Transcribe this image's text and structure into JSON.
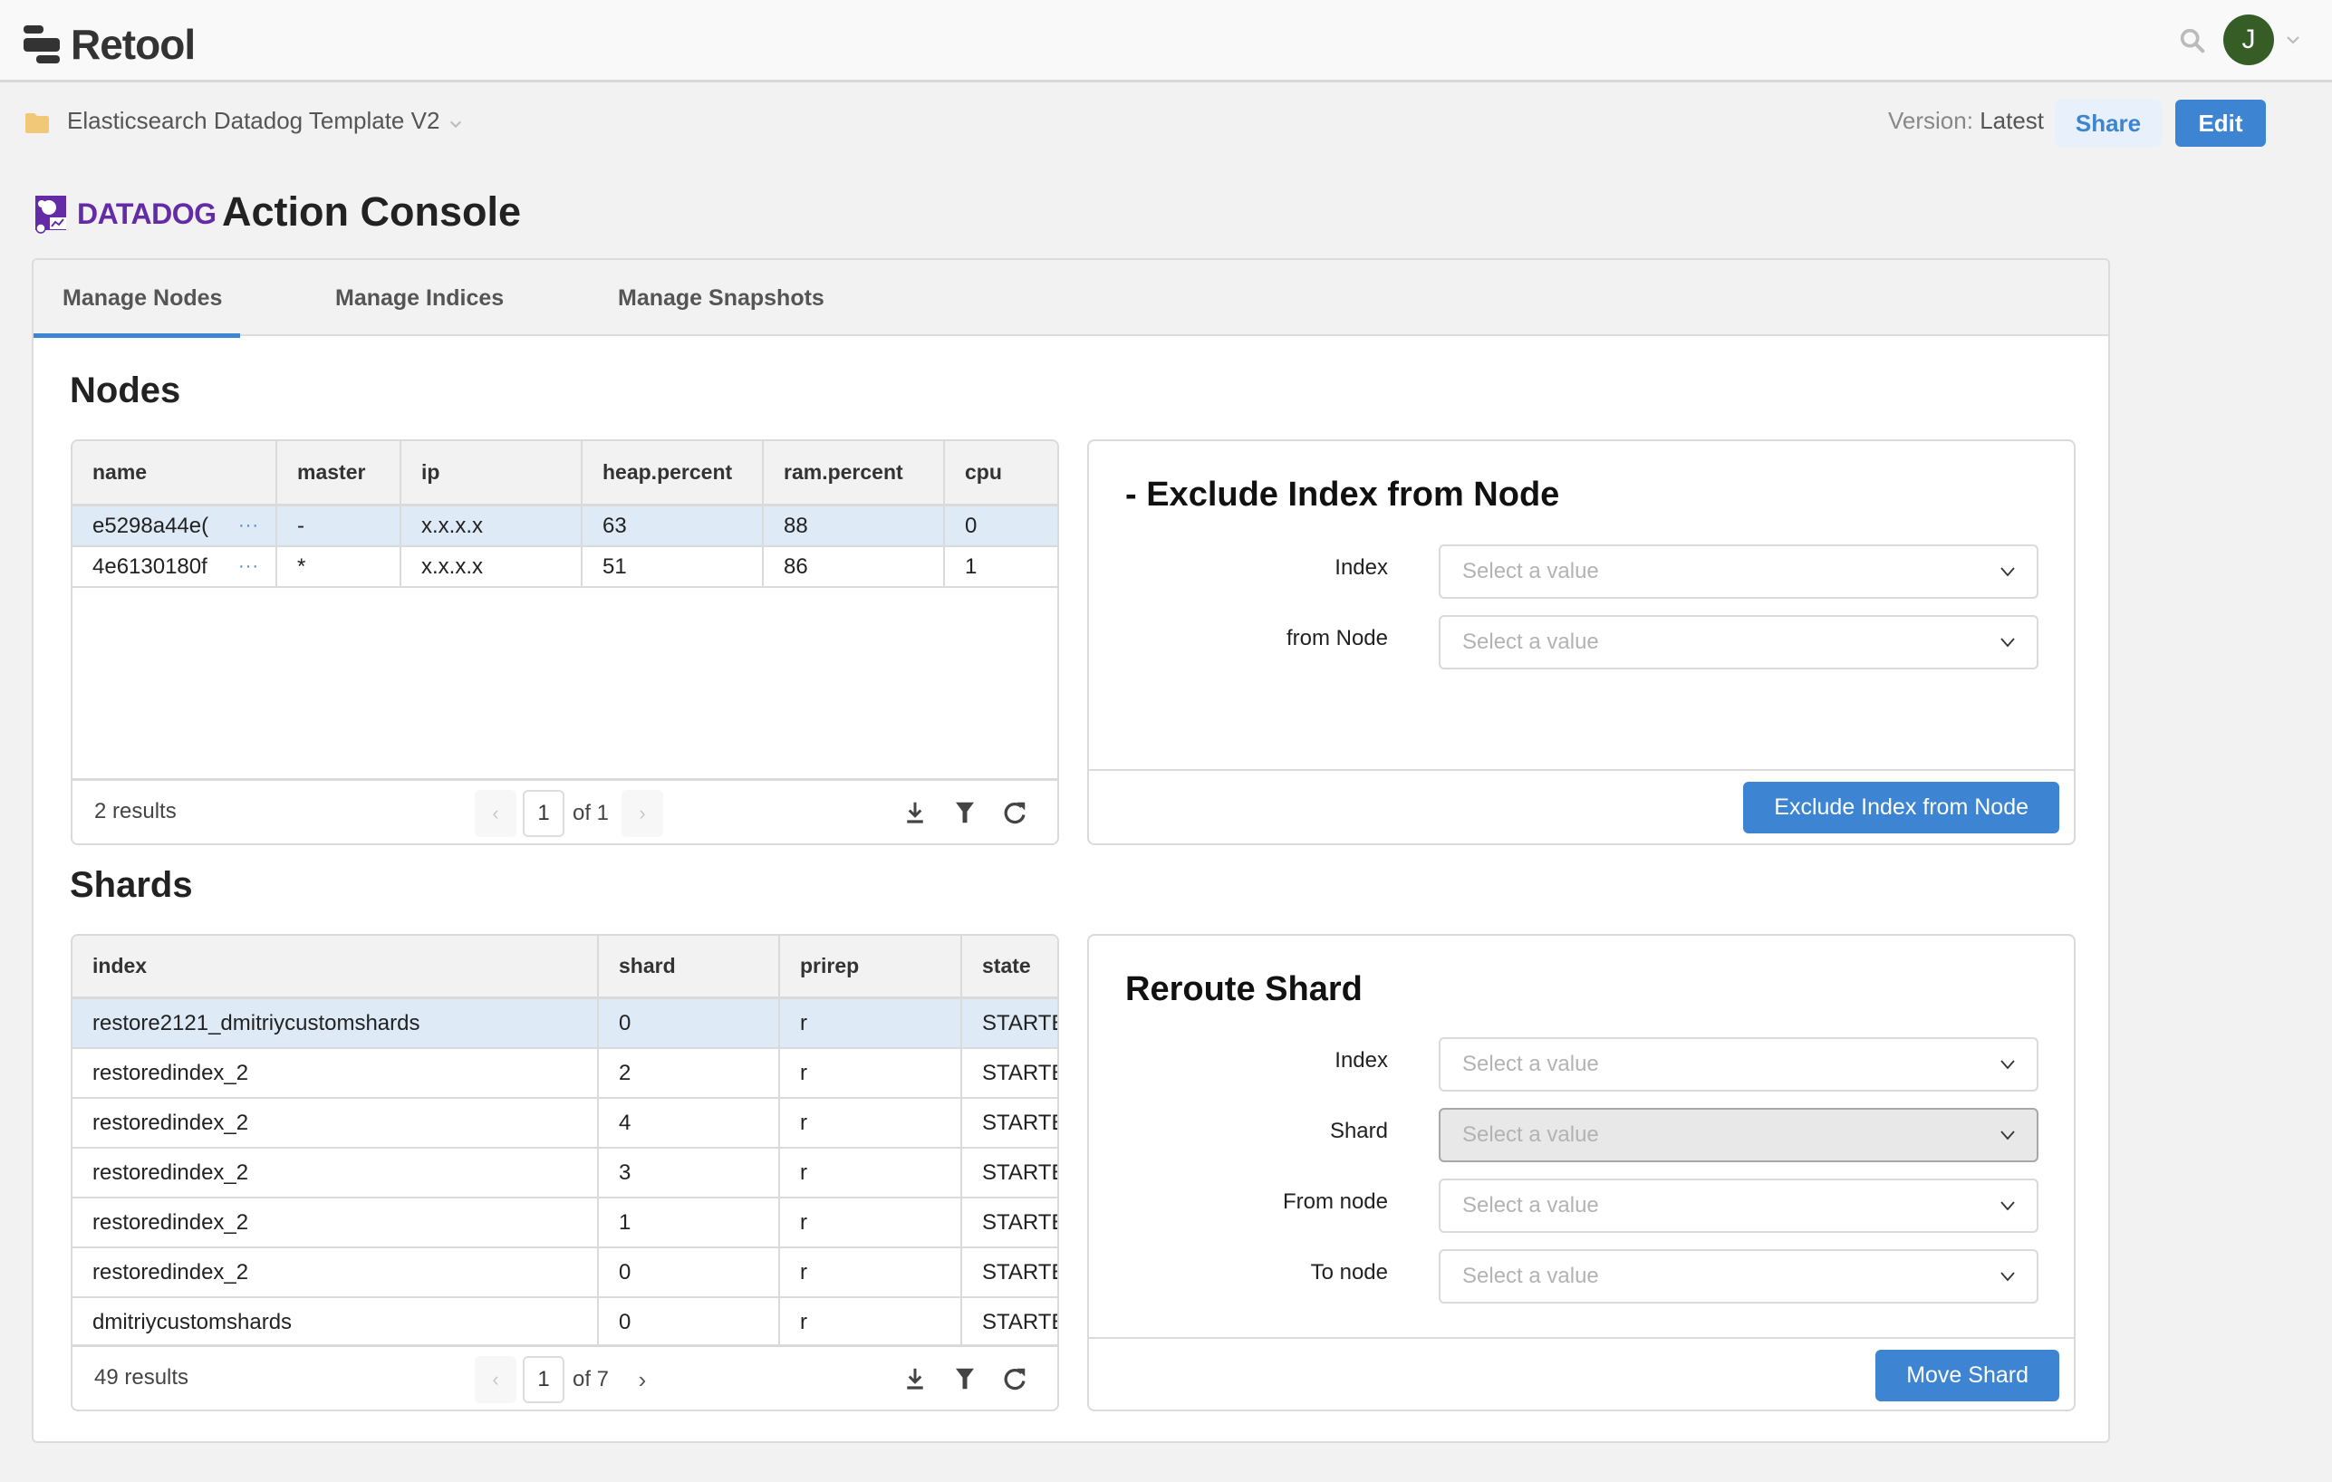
{
  "topbar": {
    "brand": "Retool",
    "avatar_initial": "J",
    "avatar_color": "#365d25"
  },
  "subbar": {
    "app_name": "Elasticsearch Datadog Template V2",
    "version_label": "Version:",
    "version_value": "Latest",
    "share_label": "Share",
    "edit_label": "Edit"
  },
  "header": {
    "partner_logo": "DATADOG",
    "title": "Action Console"
  },
  "tabs": [
    {
      "label": "Manage Nodes",
      "active": true
    },
    {
      "label": "Manage Indices",
      "active": false
    },
    {
      "label": "Manage Snapshots",
      "active": false
    }
  ],
  "nodes": {
    "title": "Nodes",
    "columns": [
      "name",
      "master",
      "ip",
      "heap.percent",
      "ram.percent",
      "cpu"
    ],
    "rows": [
      {
        "name": "e5298a44e(",
        "master": "-",
        "ip": "x.x.x.x",
        "heap_percent": "63",
        "ram_percent": "88",
        "cpu": "0",
        "selected": true
      },
      {
        "name": "4e6130180f",
        "master": "*",
        "ip": "x.x.x.x",
        "heap_percent": "51",
        "ram_percent": "86",
        "cpu": "1",
        "selected": false
      }
    ],
    "more_icon": "···",
    "results": "2 results",
    "page": "1",
    "of_pages": "of 1",
    "prev": "‹",
    "next": "›"
  },
  "exclude_form": {
    "title": "- Exclude Index from Node",
    "fields": [
      {
        "label": "Index",
        "placeholder": "Select a value"
      },
      {
        "label": "from Node",
        "placeholder": "Select a value"
      }
    ],
    "submit_label": "Exclude Index from Node"
  },
  "shards": {
    "title": "Shards",
    "columns": [
      "index",
      "shard",
      "prirep",
      "state"
    ],
    "rows": [
      {
        "index": "restore2121_dmitriycustomshards",
        "shard": "0",
        "prirep": "r",
        "state": "STARTED",
        "selected": true
      },
      {
        "index": "restoredindex_2",
        "shard": "2",
        "prirep": "r",
        "state": "STARTED",
        "selected": false
      },
      {
        "index": "restoredindex_2",
        "shard": "4",
        "prirep": "r",
        "state": "STARTED",
        "selected": false
      },
      {
        "index": "restoredindex_2",
        "shard": "3",
        "prirep": "r",
        "state": "STARTED",
        "selected": false
      },
      {
        "index": "restoredindex_2",
        "shard": "1",
        "prirep": "r",
        "state": "STARTED",
        "selected": false
      },
      {
        "index": "restoredindex_2",
        "shard": "0",
        "prirep": "r",
        "state": "STARTED",
        "selected": false
      },
      {
        "index": "dmitriycustomshards",
        "shard": "0",
        "prirep": "r",
        "state": "STARTED",
        "selected": false
      }
    ],
    "results": "49 results",
    "page": "1",
    "of_pages": "of 7",
    "prev": "‹",
    "next": "›"
  },
  "reroute_form": {
    "title": "Reroute Shard",
    "fields": [
      {
        "label": "Index",
        "placeholder": "Select a value",
        "disabled": false
      },
      {
        "label": "Shard",
        "placeholder": "Select a value",
        "disabled": true
      },
      {
        "label": "From node",
        "placeholder": "Select a value",
        "disabled": false
      },
      {
        "label": "To node",
        "placeholder": "Select a value",
        "disabled": false
      }
    ],
    "submit_label": "Move Shard"
  },
  "colors": {
    "accent": "#3d85d2",
    "datadog_purple": "#632ca6",
    "selected_row": "#deeaf6",
    "folder": "#f0c878"
  }
}
